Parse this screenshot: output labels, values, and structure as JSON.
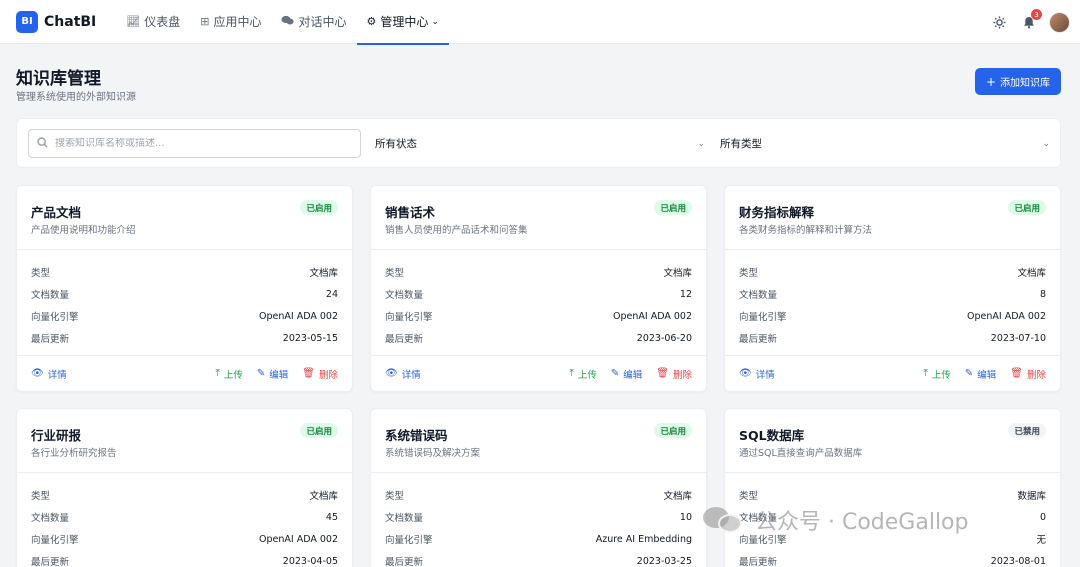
{
  "header": {
    "logo_badge": "BI",
    "app_name": "ChatBI",
    "nav": [
      {
        "label": "仪表盘",
        "icon": "line-chart-icon"
      },
      {
        "label": "应用中心",
        "icon": "grid-icon"
      },
      {
        "label": "对话中心",
        "icon": "chat-bubbles-icon"
      },
      {
        "label": "管理中心",
        "icon": "gear-icon",
        "active": true
      }
    ],
    "notification_count": "3"
  },
  "page": {
    "title": "知识库管理",
    "subtitle": "管理系统使用的外部知识源",
    "add_button": "添加知识库"
  },
  "filters": {
    "search_placeholder": "搜索知识库名称或描述...",
    "status_selected": "所有状态",
    "type_selected": "所有类型"
  },
  "labels": {
    "type": "类型",
    "doc_count": "文档数量",
    "engine": "向量化引擎",
    "updated": "最后更新",
    "detail": "详情",
    "upload": "上传",
    "edit": "编辑",
    "delete": "删除"
  },
  "cards": [
    {
      "title": "产品文档",
      "desc": "产品使用说明和功能介绍",
      "status": "已启用",
      "type": "文档库",
      "doc_count": "24",
      "engine": "OpenAI ADA 002",
      "updated": "2023-05-15"
    },
    {
      "title": "销售话术",
      "desc": "销售人员使用的产品话术和问答集",
      "status": "已启用",
      "type": "文档库",
      "doc_count": "12",
      "engine": "OpenAI ADA 002",
      "updated": "2023-06-20"
    },
    {
      "title": "财务指标解释",
      "desc": "各类财务指标的解释和计算方法",
      "status": "已启用",
      "type": "文档库",
      "doc_count": "8",
      "engine": "OpenAI ADA 002",
      "updated": "2023-07-10"
    },
    {
      "title": "行业研报",
      "desc": "各行业分析研究报告",
      "status": "已启用",
      "type": "文档库",
      "doc_count": "45",
      "engine": "OpenAI ADA 002",
      "updated": "2023-04-05"
    },
    {
      "title": "系统错误码",
      "desc": "系统错误码及解决方案",
      "status": "已启用",
      "type": "文档库",
      "doc_count": "10",
      "engine": "Azure AI Embedding",
      "updated": "2023-03-25"
    },
    {
      "title": "SQL数据库",
      "desc": "通过SQL直接查询产品数据库",
      "status": "已禁用",
      "type": "数据库",
      "doc_count": "0",
      "engine": "无",
      "updated": "2023-08-01"
    }
  ],
  "watermark": "公众号 · CodeGallop"
}
